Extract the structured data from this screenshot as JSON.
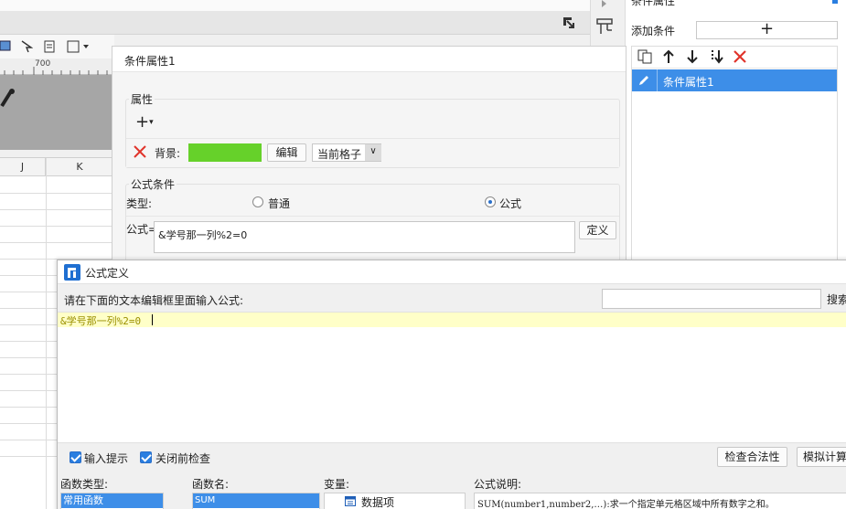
{
  "background": {
    "ruler_mark": "700",
    "columns": [
      "J",
      "K"
    ]
  },
  "right_panel": {
    "title": "条件属性",
    "add_condition_label": "添加条件",
    "add_symbol": "+",
    "items": [
      {
        "label": "条件属性1",
        "selected": true
      }
    ]
  },
  "condition_dialog": {
    "title": "条件属性1",
    "attribute_group": {
      "title": "属性",
      "add_symbol": "+",
      "background_label": "背景:",
      "background_color": "#66d12a",
      "edit_button": "编辑",
      "scope_select": "当前格子"
    },
    "formula_group": {
      "title": "公式条件",
      "type_label": "类型:",
      "option_normal": "普通",
      "option_formula": "公式",
      "selected": "公式",
      "formula_label": "公式=",
      "formula_value": "&学号那一列%2=0",
      "define_button": "定义"
    }
  },
  "formula_dialog": {
    "title": "公式定义",
    "instruction": "请在下面的文本编辑框里面输入公式:",
    "search_button": "搜索",
    "formula_text": "&学号那一列%2=0",
    "checkbox_hint": "输入提示",
    "checkbox_check": "关闭前检查",
    "validate_button": "检查合法性",
    "simulate_button": "模拟计算",
    "columns": {
      "function_type": "函数类型:",
      "function_name": "函数名:",
      "variable": "变量:",
      "description": "公式说明:"
    },
    "function_type_selected": "常用函数",
    "function_name_selected": "SUM",
    "variable_item": "数据项",
    "description_text": "SUM(number1,number2,…):求一个指定单元格区域中所有数字之和。"
  },
  "colors": {
    "accent": "#3d8ee8",
    "delete_red": "#e0342b",
    "editor_highlight": "#ffffc8",
    "formula_text": "#9a8f00"
  }
}
